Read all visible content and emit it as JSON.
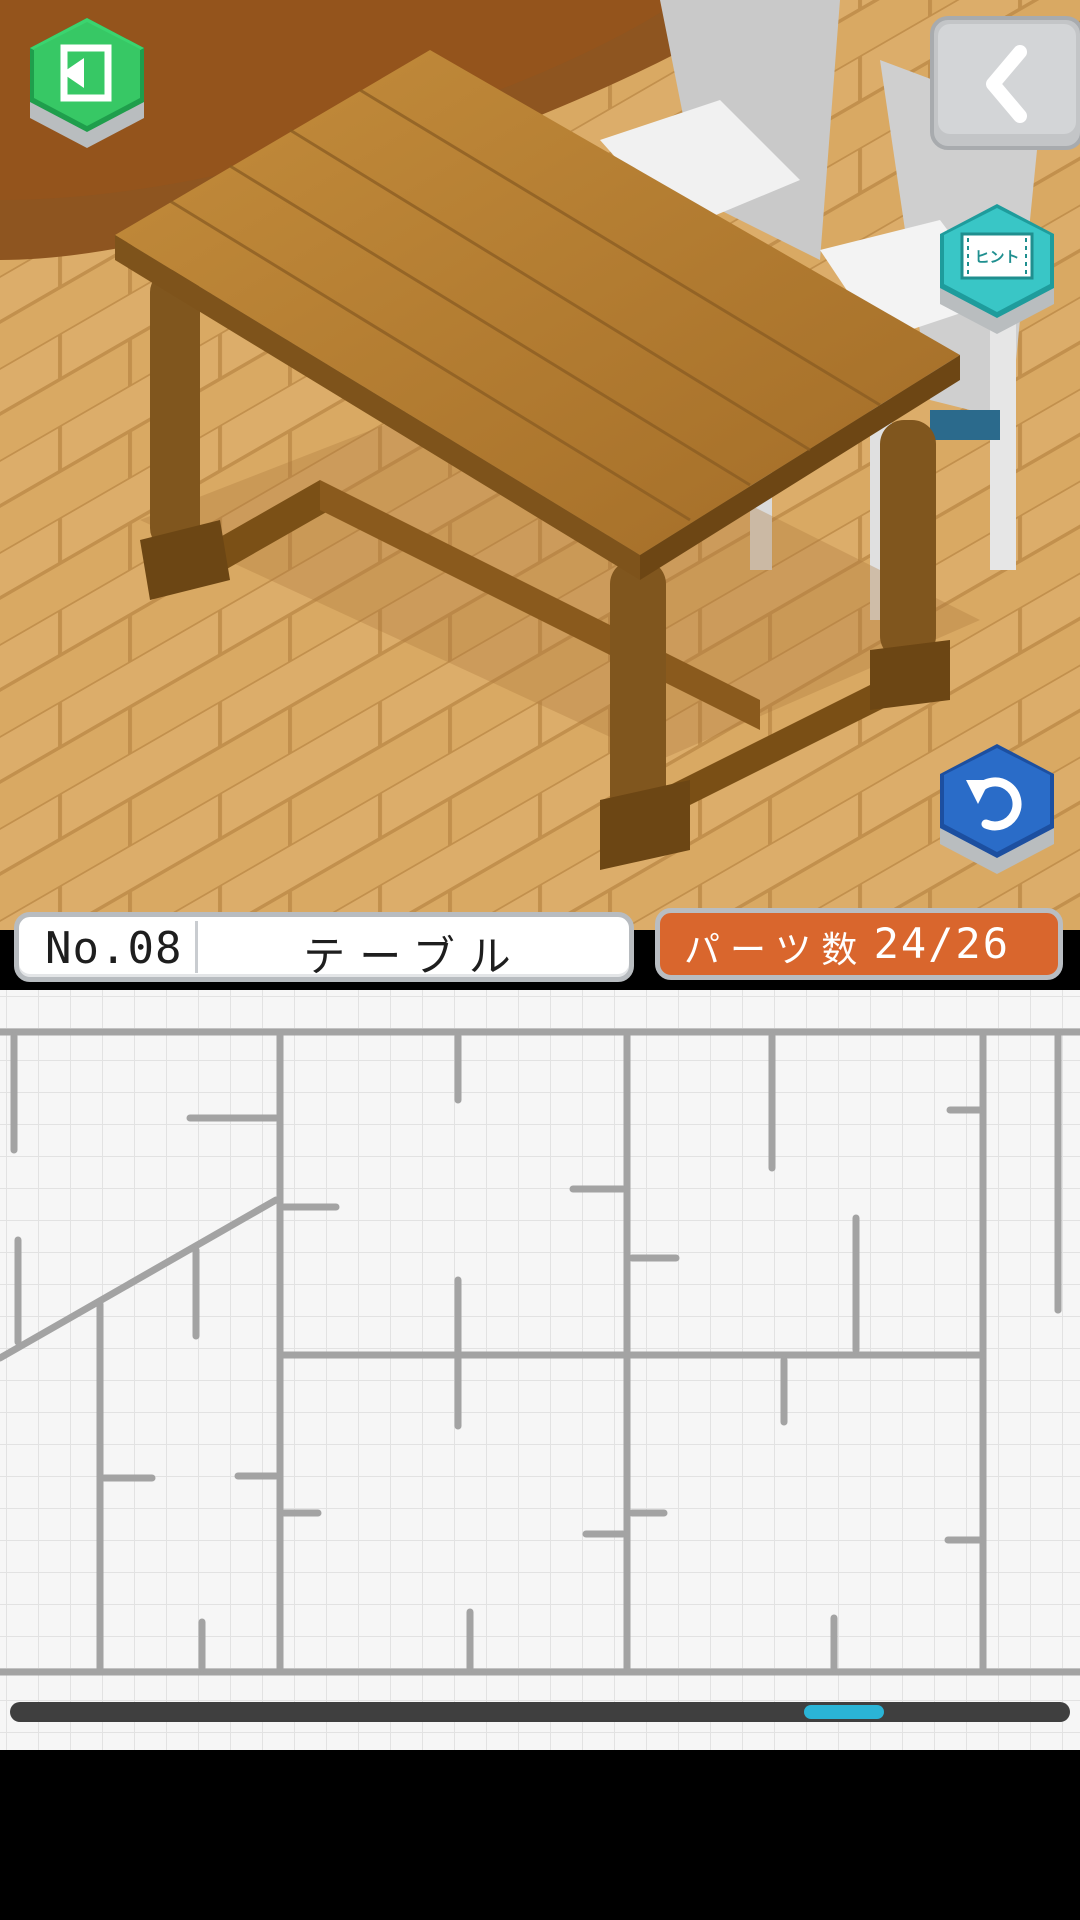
{
  "level": {
    "number_label": "No.08",
    "title": "テーブル"
  },
  "parts": {
    "label": "パーツ数",
    "count": "24/26",
    "placed": 24,
    "total": 26
  },
  "buttons": {
    "hint_label": "ヒント"
  },
  "icons": {
    "exit": "exit-door-icon",
    "back": "chevron-left-icon",
    "hint": "hint-video-icon",
    "undo": "undo-arrow-icon"
  },
  "scroll": {
    "position": 0.81
  },
  "colors": {
    "floor": "#d8a760",
    "wood": "#a87533",
    "exit_button": "#3ac96a",
    "hint_button": "#39c6c6",
    "undo_button": "#2a6cc8",
    "parts_badge": "#d9662d",
    "scroll_thumb": "#2ab4d6"
  }
}
